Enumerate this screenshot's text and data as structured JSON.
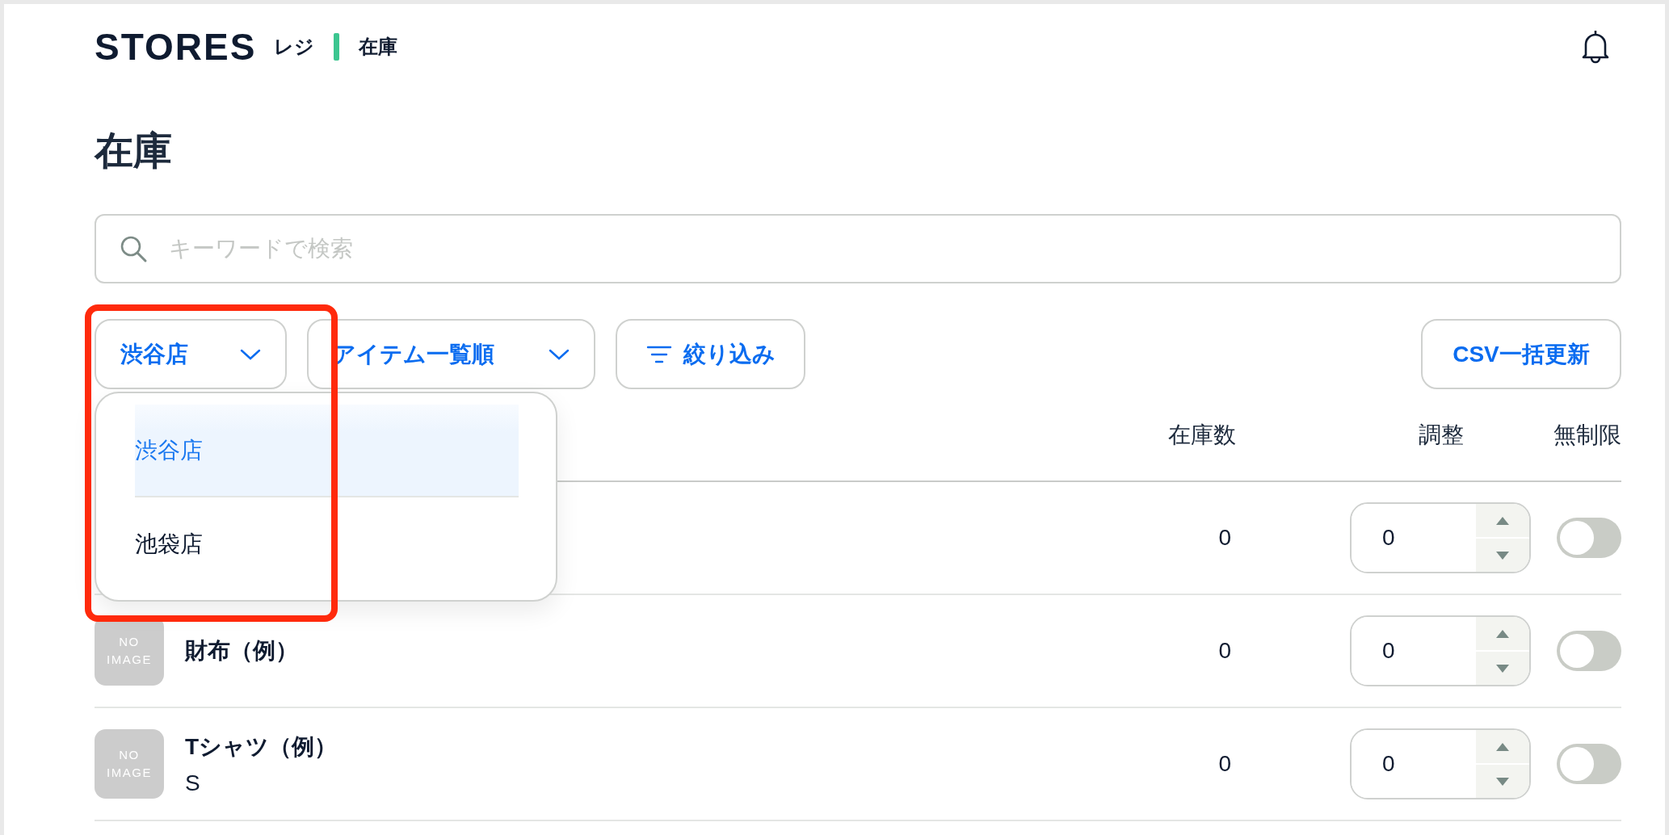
{
  "header": {
    "logo": "STORES",
    "app": "レジ",
    "section": "在庫"
  },
  "title": "在庫",
  "search": {
    "placeholder": "キーワードで検索"
  },
  "filters": {
    "store": {
      "label": "渋谷店",
      "expanded": true
    },
    "sort": {
      "label": "アイテム一覧順"
    },
    "filter_button": "絞り込み",
    "csv_button": "CSV一括更新"
  },
  "store_menu": [
    {
      "label": "渋谷店",
      "selected": true
    },
    {
      "label": "池袋店",
      "selected": false
    }
  ],
  "table": {
    "columns": [
      "在庫数",
      "調整",
      "無制限"
    ],
    "rows": [
      {
        "stock": "0",
        "adjust": "0",
        "unlimited": false
      },
      {
        "thumbnail": "NO IMAGE",
        "name": "財布（例）",
        "stock": "0",
        "adjust": "0",
        "unlimited": false
      },
      {
        "thumbnail": "NO IMAGE",
        "name": "Tシャツ（例）",
        "variant": "S",
        "stock": "0",
        "adjust": "0",
        "unlimited": false
      }
    ]
  }
}
